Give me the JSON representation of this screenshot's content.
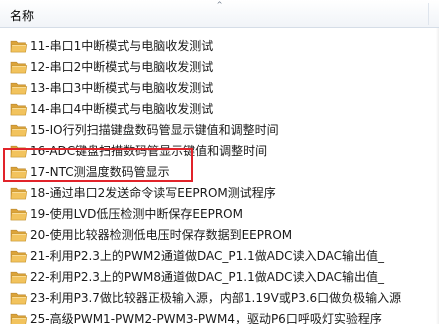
{
  "header": {
    "column_name": "名称",
    "sort_indicator": "^"
  },
  "colors": {
    "folder_front": "#f2c35d",
    "folder_back": "#dca43a",
    "highlight_border": "#e1232a"
  },
  "icon": "folder-icon",
  "items": [
    {
      "label": "11-串口1中断模式与电脑收发测试"
    },
    {
      "label": "12-串口2中断模式与电脑收发测试"
    },
    {
      "label": "13-串口3中断模式与电脑收发测试"
    },
    {
      "label": "14-串口4中断模式与电脑收发测试"
    },
    {
      "label": "15-IO行列扫描键盘数码管显示键值和调整时间"
    },
    {
      "label": "16-ADC键盘扫描数码管显示键值和调整时间"
    },
    {
      "label": "17-NTC测温度数码管显示"
    },
    {
      "label": "18-通过串口2发送命令读写EEPROM测试程序"
    },
    {
      "label": "19-使用LVD低压检测中断保存EEPROM"
    },
    {
      "label": "20-使用比较器检测低电压时保存数据到EEPROM"
    },
    {
      "label": "21-利用P2.3上的PWM2通道做DAC_P1.1做ADC读入DAC输出值_"
    },
    {
      "label": "22-利用P2.3上的PWM8通道做DAC_P1.1做ADC读入DAC输出值_"
    },
    {
      "label": "23-利用P3.7做比较器正极输入源，内部1.19V或P3.6口做负极输入源"
    },
    {
      "label": "25-高级PWM1-PWM2-PWM3-PWM4，驱动P6口呼吸灯实验程序"
    }
  ]
}
